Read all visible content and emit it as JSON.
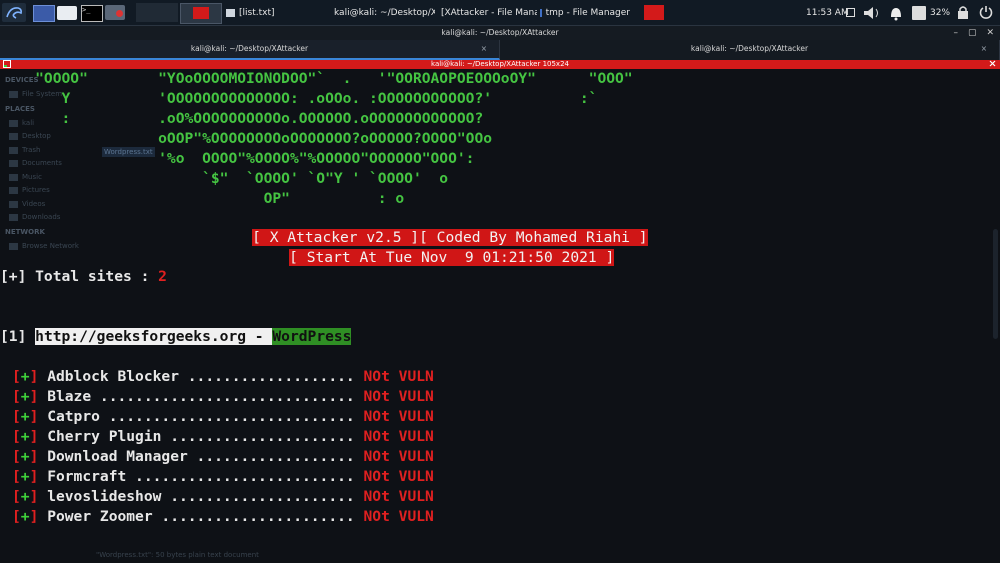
{
  "panel": {
    "icons": [
      "kali-dragon-icon",
      "workspace-icon",
      "file-manager-icon",
      "terminal-icon",
      "screen-recorder-icon"
    ],
    "tasks": [
      {
        "label": "[list.txt]"
      },
      {
        "label": "kali@kali: ~/Desktop/XA..."
      },
      {
        "label": "[XAttacker - File Manag..."
      },
      {
        "label": "tmp - File Manager"
      }
    ],
    "clock": "11:53 AM",
    "battery": "32%"
  },
  "window": {
    "title": "kali@kali: ~/Desktop/XAttacker",
    "controls": [
      "–",
      "▢",
      "✕"
    ],
    "tabs": [
      {
        "label": "kali@kali: ~/Desktop/XAttacker",
        "close": "×"
      },
      {
        "label": "kali@kali: ~/Desktop/XAttacker",
        "close": "×"
      }
    ],
    "split_title": "kali@kali: ~/Desktop/XAttacker 105x24"
  },
  "ghost": {
    "sections": [
      {
        "header": "DEVICES",
        "items": [
          "File System"
        ]
      },
      {
        "header": "PLACES",
        "items": [
          "kali",
          "Desktop",
          "Trash",
          "Documents",
          "Music",
          "Pictures",
          "Videos",
          "Downloads"
        ]
      },
      {
        "header": "NETWORK",
        "items": [
          "Browse Network"
        ]
      }
    ],
    "selected_file": "Wordpress.txt",
    "status": "\"Wordpress.txt\": 50 bytes plain text document"
  },
  "terminal": {
    "banner": [
      "    \"OOOO\"        \"YOoOOOOMOIONODOO\"`  .   '\"OOROAOPOEOOOoOY\"      \"OOO\"",
      "       Y          'OOOOOOOOOOOOOO: .oOOo. :OOOOOOOOOOO?'          :`",
      "       :          .oO%OOOOOOOOOOo.OOOOOO.oOOOOOOOOOOOO?",
      "                  oOOP\"%OOOOOOOOoOOOOOOO?oOOOOO?OOOO\"OOo",
      "                  '%o  OOOO\"%OOOO%\"%OOOOO\"OOOOOO\"OOO':",
      "                       `$\"  `OOOO' `O\"Y ' `OOOO'  o",
      "                              OP\"          : o"
    ],
    "header1": "[ X Attacker v2.5 ][ Coded By Mohamed Riahi ]",
    "header2": "[ Start At Tue Nov  9 01:21:50 2021 ]",
    "total_label": "[+] Total sites : ",
    "total_value": "2",
    "site_index": "[1] ",
    "site_url": "http://geeksforgeeks.org - ",
    "site_cms": "WordPress",
    "plugins": [
      {
        "name": "Adblock Blocker ...................",
        "status": "NOt VULN"
      },
      {
        "name": "Blaze .............................",
        "status": "NOt VULN"
      },
      {
        "name": "Catpro ............................",
        "status": "NOt VULN"
      },
      {
        "name": "Cherry Plugin .....................",
        "status": "NOt VULN"
      },
      {
        "name": "Download Manager ..................",
        "status": "NOt VULN"
      },
      {
        "name": "Formcraft .........................",
        "status": "NOt VULN"
      },
      {
        "name": "levoslideshow .....................",
        "status": "NOt VULN"
      },
      {
        "name": "Power Zoomer ......................",
        "status": "NOt VULN"
      }
    ],
    "plus_open": "[",
    "plus_mid": "+",
    "plus_close": "]"
  },
  "colors": {
    "terminal_bg": "#0e1116",
    "banner_green": "#45c442",
    "accent_red": "#d01616",
    "cms_green": "#2f8f24"
  }
}
